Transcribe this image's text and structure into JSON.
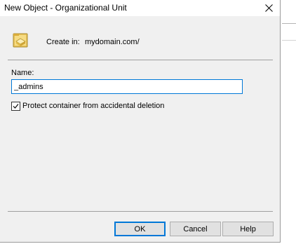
{
  "window": {
    "title": "New Object - Organizational Unit",
    "close_glyph": "close-icon"
  },
  "header": {
    "icon": "organizational-unit-icon",
    "create_in_label": "Create in:",
    "create_in_path": "mydomain.com/"
  },
  "form": {
    "name_label": "Name:",
    "name_value": "_admins",
    "protect_checkbox": {
      "label": "Protect container from accidental deletion",
      "checked": true
    }
  },
  "buttons": {
    "ok": "OK",
    "cancel": "Cancel",
    "help": "Help"
  },
  "colors": {
    "accent": "#0078d7",
    "dialog_bg": "#f0f0f0",
    "button_bg": "#e1e1e1"
  }
}
